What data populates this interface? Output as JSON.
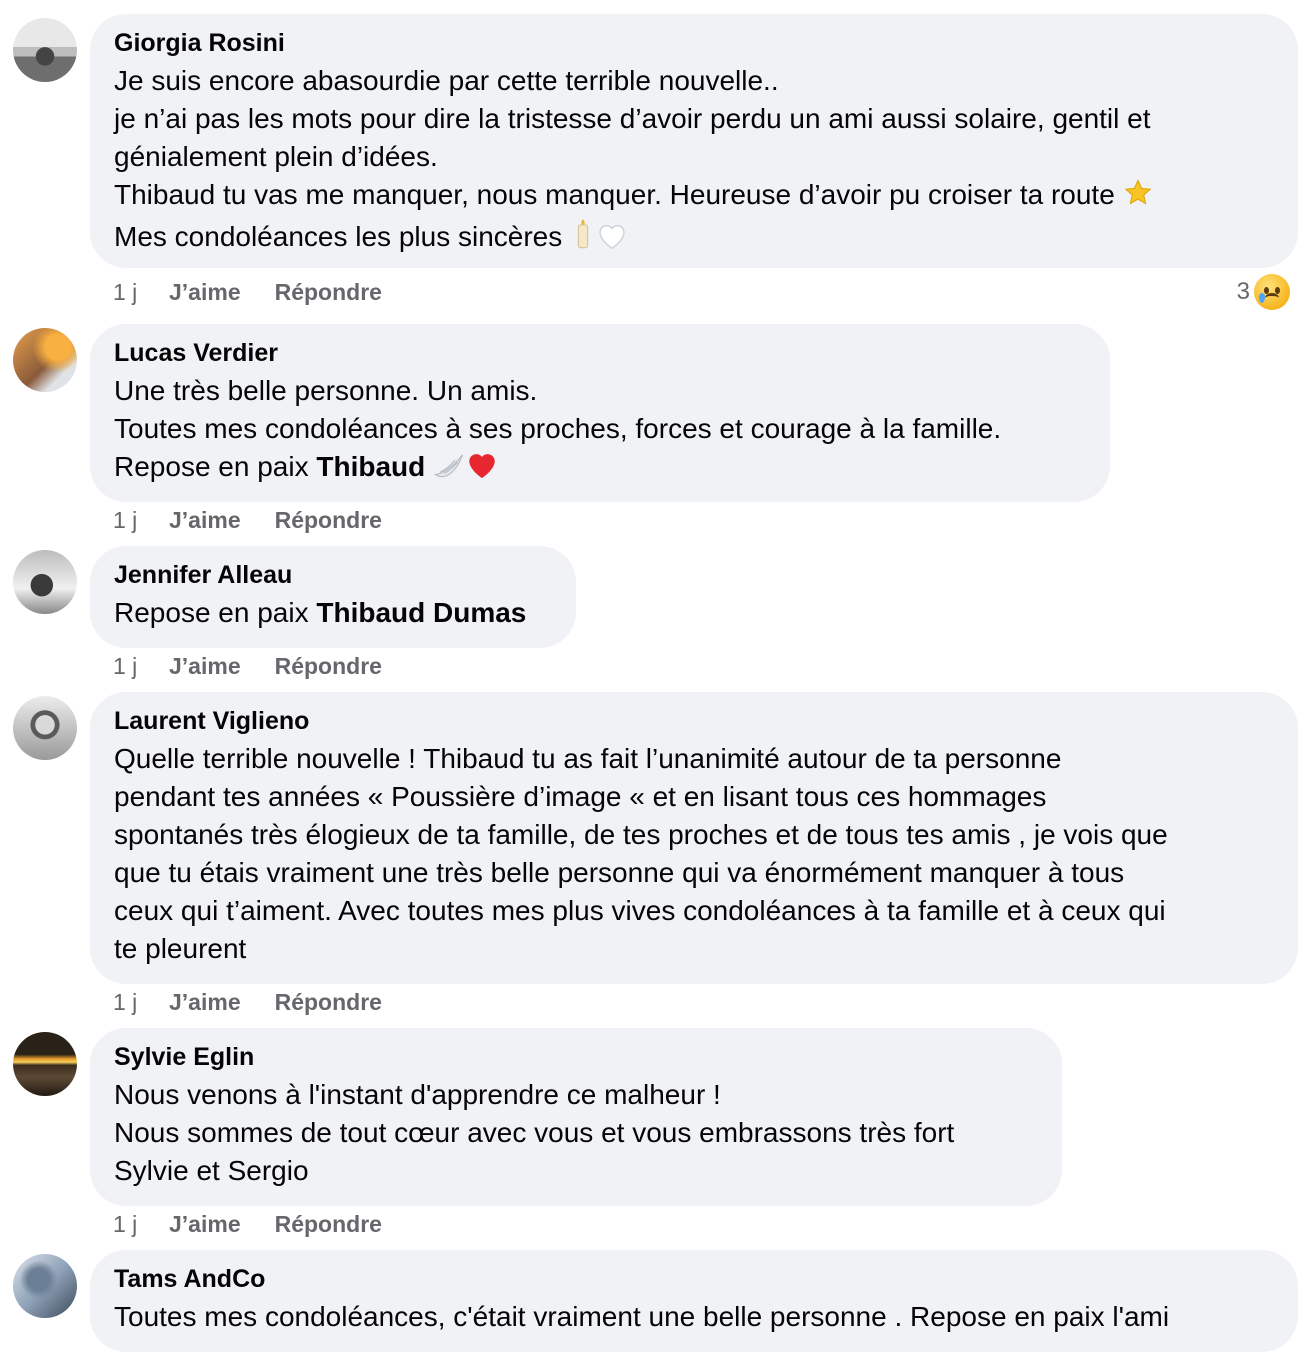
{
  "comments": [
    {
      "author": "Giorgia Rosini",
      "lines": [
        "Je suis encore abasourdie par cette terrible nouvelle..",
        "je n’ai pas les mots pour dire la tristesse d’avoir perdu un ami aussi solaire, gentil et",
        "génialement plein d’idées.",
        "Thibaud tu vas me manquer, nous manquer. Heureuse d’avoir pu croiser ta route",
        "Mes condoléances les plus sincères"
      ],
      "time": "1 j",
      "like": "J’aime",
      "reply": "Répondre",
      "reaction_count": "3",
      "reaction_icon": "crying-face-icon"
    },
    {
      "author": "Lucas Verdier",
      "lines": [
        "Une très belle personne. Un amis.",
        "Toutes mes condoléances à ses proches, forces et courage à la famille.",
        "Repose en paix"
      ],
      "mention": "Thibaud",
      "time": "1 j",
      "like": "J’aime",
      "reply": "Répondre"
    },
    {
      "author": "Jennifer Alleau",
      "lines": [
        "Repose en paix"
      ],
      "mention": "Thibaud Dumas",
      "time": "1 j",
      "like": "J’aime",
      "reply": "Répondre"
    },
    {
      "author": "Laurent Viglieno",
      "lines": [
        "Quelle terrible nouvelle ! Thibaud tu as fait l’unanimité autour de ta personne",
        "pendant tes années « Poussière d’image « et en lisant tous ces hommages",
        "spontanés très élogieux de ta famille, de tes proches et de tous tes amis , je vois que",
        "que tu étais vraiment une très belle personne qui va énormément manquer à tous",
        "ceux qui t’aiment. Avec toutes mes plus vives condoléances à ta famille et à ceux qui",
        "te pleurent"
      ],
      "time": "1 j",
      "like": "J’aime",
      "reply": "Répondre"
    },
    {
      "author": "Sylvie Eglin",
      "lines": [
        "Nous venons à l'instant d'apprendre ce malheur !",
        "Nous sommes de tout cœur avec vous et vous embrassons très fort",
        "Sylvie et Sergio"
      ],
      "time": "1 j",
      "like": "J’aime",
      "reply": "Répondre"
    },
    {
      "author": "Tams AndCo",
      "lines": [
        "Toutes mes condoléances, c'était vraiment une belle personne . Repose en paix l'ami"
      ]
    }
  ],
  "colors": {
    "bubble": "#f0f2f5",
    "meta": "#65676b",
    "text": "#050505"
  }
}
